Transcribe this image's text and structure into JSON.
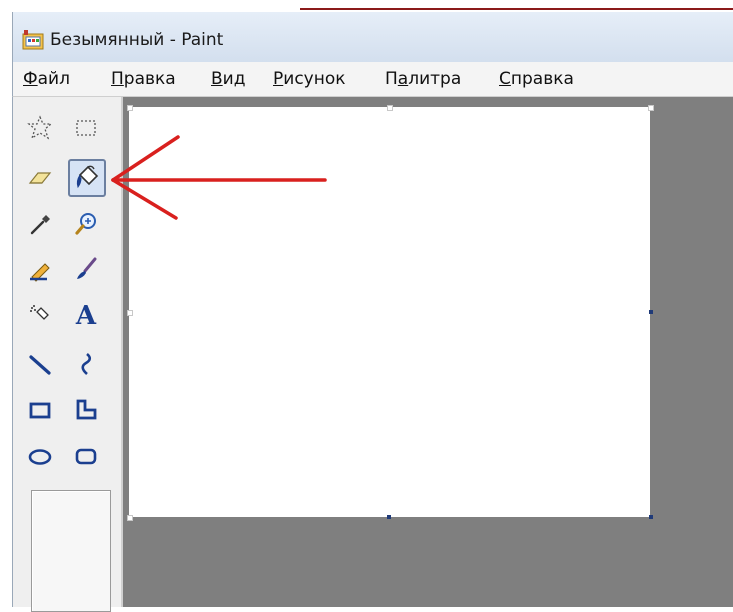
{
  "window": {
    "title": "Безымянный - Paint",
    "app_icon": "paint-app-icon"
  },
  "menu": {
    "items": [
      {
        "label_ul": "Ф",
        "label_rest": "айл"
      },
      {
        "label_ul": "П",
        "label_rest": "равка"
      },
      {
        "label_ul": "В",
        "label_rest": "ид"
      },
      {
        "label_ul": "Р",
        "label_rest": "исунок"
      },
      {
        "label_pre": "П",
        "label_ul": "а",
        "label_rest": "литра"
      },
      {
        "label_ul": "С",
        "label_rest": "правка"
      }
    ]
  },
  "toolbox": {
    "tools": [
      {
        "name": "free-form-select-icon"
      },
      {
        "name": "rectangle-select-icon"
      },
      {
        "name": "eraser-icon"
      },
      {
        "name": "fill-bucket-icon",
        "selected": true
      },
      {
        "name": "color-picker-icon"
      },
      {
        "name": "magnifier-icon"
      },
      {
        "name": "pencil-icon"
      },
      {
        "name": "brush-icon"
      },
      {
        "name": "airbrush-icon"
      },
      {
        "name": "text-tool-icon",
        "glyph": "A"
      },
      {
        "name": "line-icon"
      },
      {
        "name": "curve-icon"
      },
      {
        "name": "rectangle-icon"
      },
      {
        "name": "polygon-icon"
      },
      {
        "name": "ellipse-icon"
      },
      {
        "name": "rounded-rectangle-icon"
      }
    ]
  },
  "colors": {
    "canvas_bg": "#ffffff",
    "workspace_bg": "#7f7f7f",
    "annotation": "#d9201e",
    "tool_blue": "#1b3f8f"
  },
  "annotation": {
    "target": "fill-bucket-icon",
    "shape": "arrow"
  }
}
